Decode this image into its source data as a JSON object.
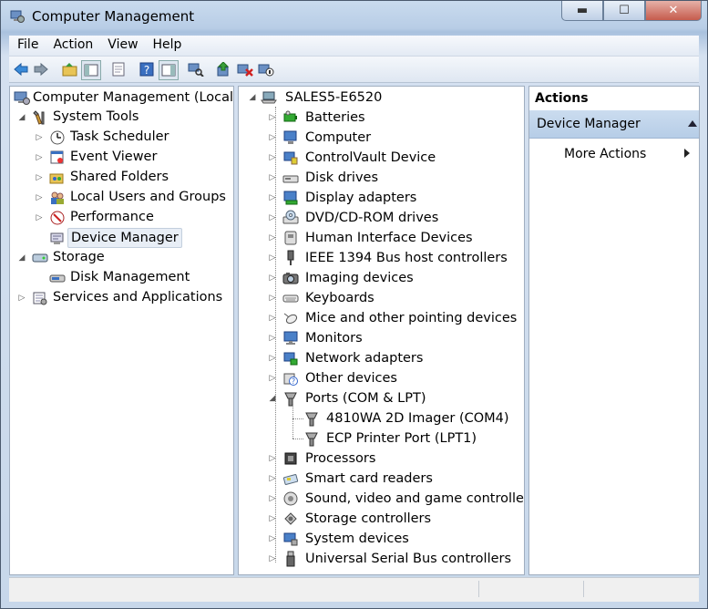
{
  "window": {
    "title": "Computer Management",
    "controls": [
      "minimize",
      "maximize",
      "close"
    ]
  },
  "menu": [
    "File",
    "Action",
    "View",
    "Help"
  ],
  "toolbar_icons": [
    "back-icon",
    "forward-icon",
    "up-folder-icon",
    "show-hide-console-tree-icon",
    "properties-icon",
    "help-icon",
    "show-hide-action-pane-icon",
    "scan-hardware-icon",
    "update-driver-icon",
    "uninstall-icon",
    "disable-icon"
  ],
  "left_tree": {
    "root": "Computer Management (Local)",
    "items": [
      {
        "label": "System Tools",
        "level": 1,
        "expander": "expanded",
        "icon": "tools-icon"
      },
      {
        "label": "Task Scheduler",
        "level": 2,
        "expander": "collapsed",
        "icon": "clock-icon"
      },
      {
        "label": "Event Viewer",
        "level": 2,
        "expander": "collapsed",
        "icon": "event-viewer-icon"
      },
      {
        "label": "Shared Folders",
        "level": 2,
        "expander": "collapsed",
        "icon": "shared-folder-icon"
      },
      {
        "label": "Local Users and Groups",
        "level": 2,
        "expander": "collapsed",
        "icon": "users-icon"
      },
      {
        "label": "Performance",
        "level": 2,
        "expander": "collapsed",
        "icon": "performance-icon"
      },
      {
        "label": "Device Manager",
        "level": 2,
        "expander": "none",
        "icon": "device-manager-icon",
        "selected": true
      },
      {
        "label": "Storage",
        "level": 1,
        "expander": "expanded",
        "icon": "storage-icon"
      },
      {
        "label": "Disk Management",
        "level": 2,
        "expander": "none",
        "icon": "disk-management-icon"
      },
      {
        "label": "Services and Applications",
        "level": 1,
        "expander": "collapsed",
        "icon": "services-icon"
      }
    ]
  },
  "device_tree": {
    "root": "SALES5-E6520",
    "items": [
      {
        "label": "Batteries",
        "icon": "battery-icon"
      },
      {
        "label": "Computer",
        "icon": "computer-icon"
      },
      {
        "label": "ControlVault Device",
        "icon": "controlvault-icon"
      },
      {
        "label": "Disk drives",
        "icon": "disk-drive-icon"
      },
      {
        "label": "Display adapters",
        "icon": "display-adapter-icon"
      },
      {
        "label": "DVD/CD-ROM drives",
        "icon": "dvd-drive-icon"
      },
      {
        "label": "Human Interface Devices",
        "icon": "hid-icon"
      },
      {
        "label": "IEEE 1394 Bus host controllers",
        "icon": "ieee1394-icon"
      },
      {
        "label": "Imaging devices",
        "icon": "camera-icon"
      },
      {
        "label": "Keyboards",
        "icon": "keyboard-icon"
      },
      {
        "label": "Mice and other pointing devices",
        "icon": "mouse-icon"
      },
      {
        "label": "Monitors",
        "icon": "monitor-icon"
      },
      {
        "label": "Network adapters",
        "icon": "network-adapter-icon"
      },
      {
        "label": "Other devices",
        "icon": "other-devices-icon"
      },
      {
        "label": "Ports (COM & LPT)",
        "icon": "port-icon",
        "expanded": true,
        "children": [
          {
            "label": "4810WA 2D Imager (COM4)",
            "icon": "port-icon"
          },
          {
            "label": "ECP Printer Port (LPT1)",
            "icon": "port-icon"
          }
        ]
      },
      {
        "label": "Processors",
        "icon": "processor-icon"
      },
      {
        "label": "Smart card readers",
        "icon": "smart-card-icon"
      },
      {
        "label": "Sound, video and game controllers",
        "icon": "sound-icon"
      },
      {
        "label": "Storage controllers",
        "icon": "storage-controller-icon"
      },
      {
        "label": "System devices",
        "icon": "system-devices-icon"
      },
      {
        "label": "Universal Serial Bus controllers",
        "icon": "usb-icon"
      }
    ]
  },
  "actions": {
    "header": "Actions",
    "section": "Device Manager",
    "more": "More Actions"
  }
}
